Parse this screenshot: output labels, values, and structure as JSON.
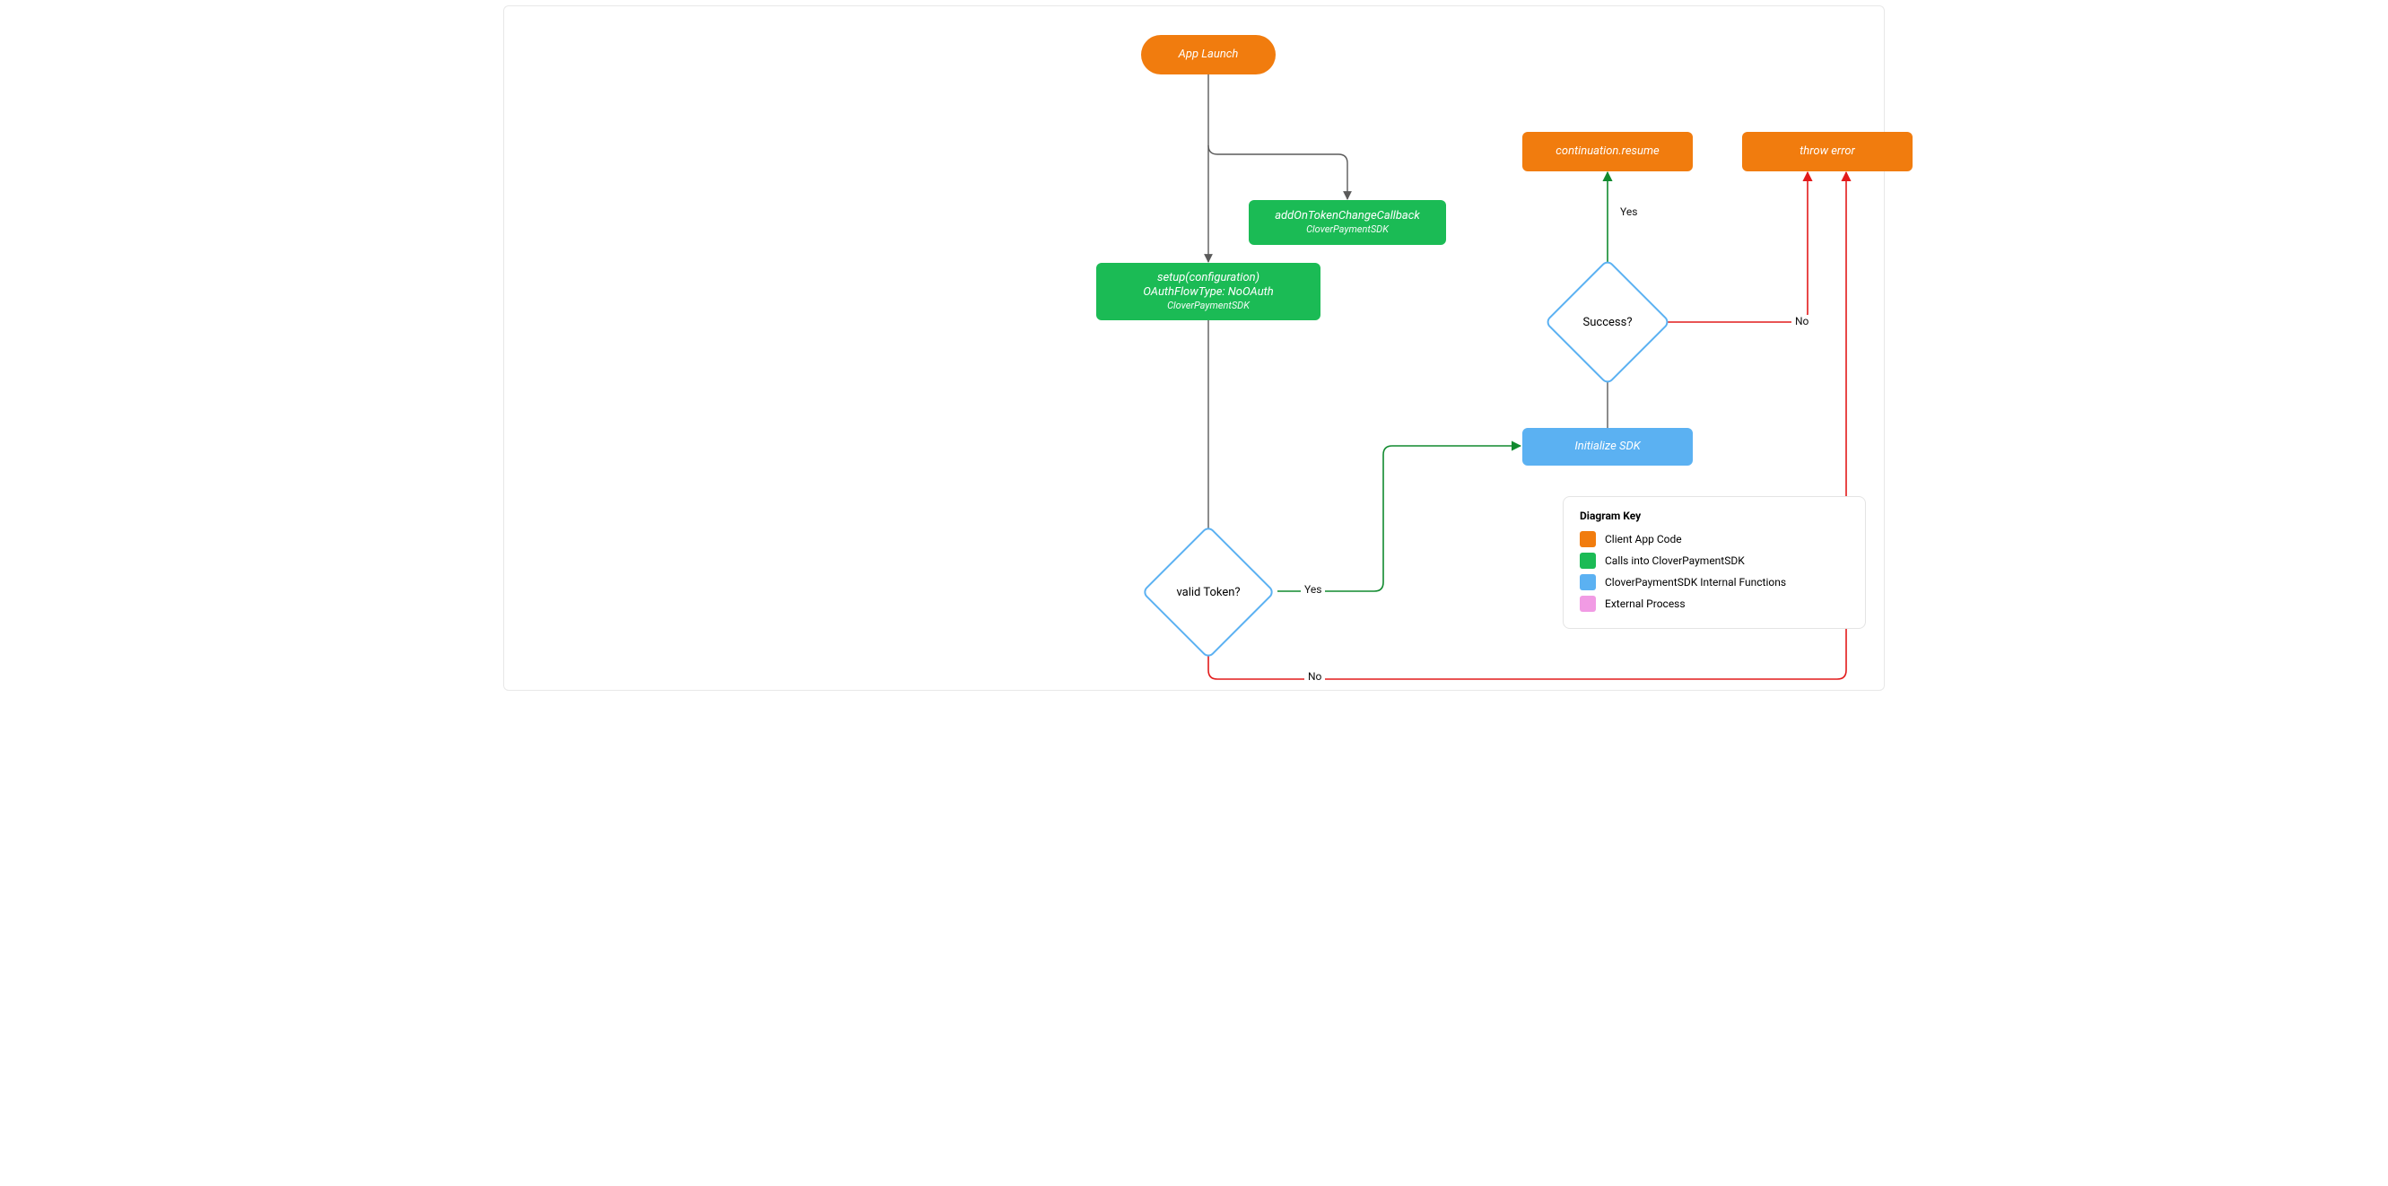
{
  "nodes": {
    "appLaunch": {
      "label": "App Launch"
    },
    "addCb": {
      "label": "addOnTokenChangeCallback",
      "sub": "CloverPaymentSDK"
    },
    "setup": {
      "line1": "setup(configuration)",
      "line2": "OAuthFlowType: NoOAuth",
      "sub": "CloverPaymentSDK"
    },
    "validToken": {
      "label": "valid Token?"
    },
    "initSdk": {
      "label": "Initialize SDK"
    },
    "success": {
      "label": "Success?"
    },
    "resume": {
      "label": "continuation.resume"
    },
    "throw": {
      "label": "throw error"
    }
  },
  "edges": {
    "yes1": "Yes",
    "no1": "No",
    "yes2": "Yes",
    "no2": "No"
  },
  "legend": {
    "title": "Diagram Key",
    "items": [
      {
        "color": "orange",
        "label": "Client App Code"
      },
      {
        "color": "green",
        "label": "Calls into CloverPaymentSDK"
      },
      {
        "color": "blue",
        "label": "CloverPaymentSDK Internal Functions"
      },
      {
        "color": "pink",
        "label": "External Process"
      }
    ]
  },
  "colors": {
    "orange": "#F17C0E",
    "green": "#1BBB55",
    "blue": "#5BB1F2",
    "pink": "#F19BE4",
    "wire": "#5A5A5A",
    "wireGreen": "#118A2F",
    "wireRed": "#E21B1B"
  }
}
